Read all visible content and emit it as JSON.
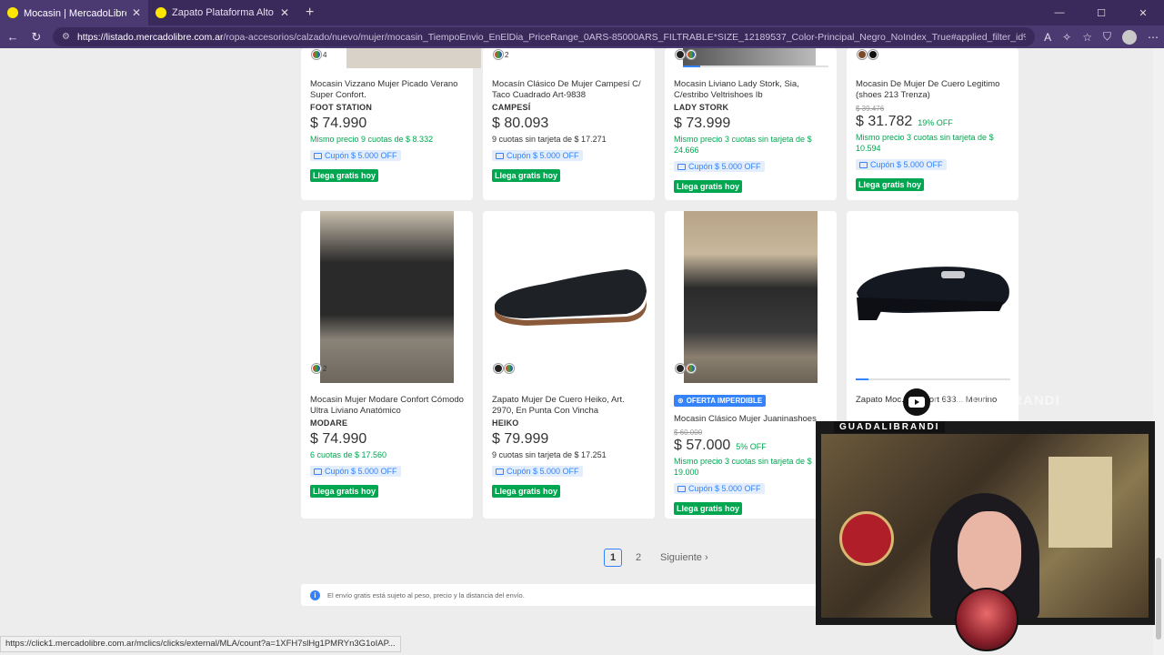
{
  "browser": {
    "tabs": [
      {
        "title": "Mocasin | MercadoLibre 📦",
        "active": true
      },
      {
        "title": "Zapato Plataforma Alto Mocasin D",
        "active": false
      }
    ],
    "url_host": "https://listado.mercadolibre.com.ar",
    "url_path": "/ropa-accesorios/calzado/nuevo/mujer/mocasin_TiempoEnvio_EnElDia_PriceRange_0ARS-85000ARS_FILTRABLE*SIZE_12189537_Color-Principal_Negro_NoIndex_True#applied_filter_id%3DFILTRABLE_GENDER%26appli..."
  },
  "colors": {
    "accent": "#3483fa",
    "green": "#00a650",
    "chrome": "#4b3a72"
  },
  "products_top": [
    {
      "swatch": "4",
      "title": "Mocasin Vizzano Mujer Picado Verano Super Confort.",
      "brand": "FOOT STATION",
      "old_price": "",
      "price": "$ 74.990",
      "discount": "",
      "installments": "Mismo precio 9 cuotas de $ 8.332",
      "inst_green": true,
      "coupon": "Cupón $ 5.000 OFF",
      "shipping": "Llega gratis hoy"
    },
    {
      "swatch": "2",
      "title": "Mocasín Clásico De Mujer Campesí C/ Taco Cuadrado Art-9838",
      "brand": "CAMPESÍ",
      "old_price": "",
      "price": "$ 80.093",
      "discount": "",
      "installments": "9 cuotas sin tarjeta de $ 17.271",
      "inst_green": false,
      "coupon": "Cupón $ 5.000 OFF",
      "shipping": "Llega gratis hoy"
    },
    {
      "swatch": "",
      "title": "Mocasin Liviano Lady Stork, Sia, C/estribo Veltrishoes Ib",
      "brand": "LADY STORK",
      "old_price": "",
      "price": "$ 73.999",
      "discount": "",
      "installments": "Mismo precio 3 cuotas sin tarjeta de $ 24.666",
      "inst_green": true,
      "coupon": "Cupón $ 5.000 OFF",
      "shipping": "Llega gratis hoy"
    },
    {
      "swatch": "",
      "title": "Mocasin De Mujer De Cuero Legitimo (shoes 213 Trenza)",
      "brand": "",
      "old_price": "$ 39.476",
      "price": "$ 31.782",
      "discount": "19% OFF",
      "installments": "Mismo precio 3 cuotas sin tarjeta de $ 10.594",
      "inst_green": true,
      "coupon": "Cupón $ 5.000 OFF",
      "shipping": "Llega gratis hoy"
    }
  ],
  "products_bottom": [
    {
      "swatch": "2",
      "badge": "",
      "title": "Mocasin Mujer Modare Confort Cómodo Ultra Liviano Anatómico",
      "brand": "MODARE",
      "old_price": "",
      "price": "$ 74.990",
      "discount": "",
      "installments": "6 cuotas de $ 17.560",
      "inst_green": true,
      "coupon": "Cupón $ 5.000 OFF",
      "shipping": "Llega gratis hoy"
    },
    {
      "swatch": "",
      "badge": "",
      "title": "Zapato Mujer De Cuero Heiko, Art. 2970, En Punta Con Vincha",
      "brand": "HEIKO",
      "old_price": "",
      "price": "$ 79.999",
      "discount": "",
      "installments": "9 cuotas sin tarjeta de $ 17.251",
      "inst_green": false,
      "coupon": "Cupón $ 5.000 OFF",
      "shipping": "Llega gratis hoy"
    },
    {
      "swatch": "",
      "badge": "OFERTA IMPERDIBLE",
      "title": "Mocasin Clásico Mujer Juaninashoes",
      "brand": "",
      "old_price": "$ 60.000",
      "price": "$ 57.000",
      "discount": "5% OFF",
      "installments": "Mismo precio 3 cuotas sin tarjeta de $ 19.000",
      "inst_green": true,
      "coupon": "Cupón $ 5.000 OFF",
      "shipping": "Llega gratis hoy"
    },
    {
      "swatch": "",
      "badge": "",
      "title": "Zapato Moc... Confort 633... Meurino",
      "brand": "",
      "old_price": "",
      "price": "",
      "discount": "",
      "installments": "",
      "inst_green": false,
      "coupon": "",
      "shipping": ""
    }
  ],
  "pagination": {
    "pages": [
      "1",
      "2"
    ],
    "current": "1",
    "next_label": "Siguiente"
  },
  "notice": "El envío gratis está sujeto al peso, precio y la distancia del envío.",
  "status_url": "https://click1.mercadolibre.com.ar/mclics/clicks/external/MLA/count?a=1XFH7slHg1PMRYn3G1oIAP...",
  "overlay": {
    "streamer_name": "GUADALIBRANDI",
    "watermark": "GUADALIBRANDI"
  }
}
